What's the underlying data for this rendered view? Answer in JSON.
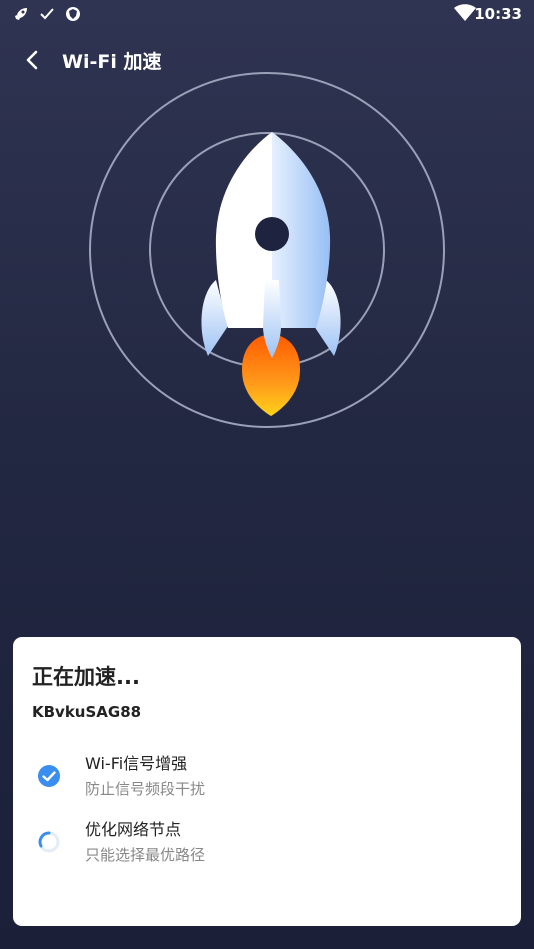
{
  "status_bar": {
    "time": "10:33",
    "left_icons": [
      "rocket-icon",
      "check-icon",
      "shield-icon"
    ],
    "right_icons": [
      "wifi-icon",
      "battery-icon"
    ]
  },
  "header": {
    "back_icon": "chevron-left-icon",
    "title": "Wi-Fi 加速"
  },
  "hero": {
    "graphic": "rocket-icon",
    "colors": {
      "rocket_body": "#ffffff",
      "rocket_shade": "#a9c9f5",
      "flame": "#ff8c1a",
      "rings": "#9aa0b8"
    }
  },
  "card": {
    "title": "正在加速...",
    "ssid": "KBvkuSAG88",
    "tasks": [
      {
        "title": "Wi-Fi信号增强",
        "subtitle": "防止信号频段干扰",
        "status": "done",
        "icon": "check-circle-icon"
      },
      {
        "title": "优化网络节点",
        "subtitle": "只能选择最优路径",
        "status": "in-progress",
        "icon": "spinner-icon"
      }
    ],
    "accent_color": "#3a8ef0"
  }
}
